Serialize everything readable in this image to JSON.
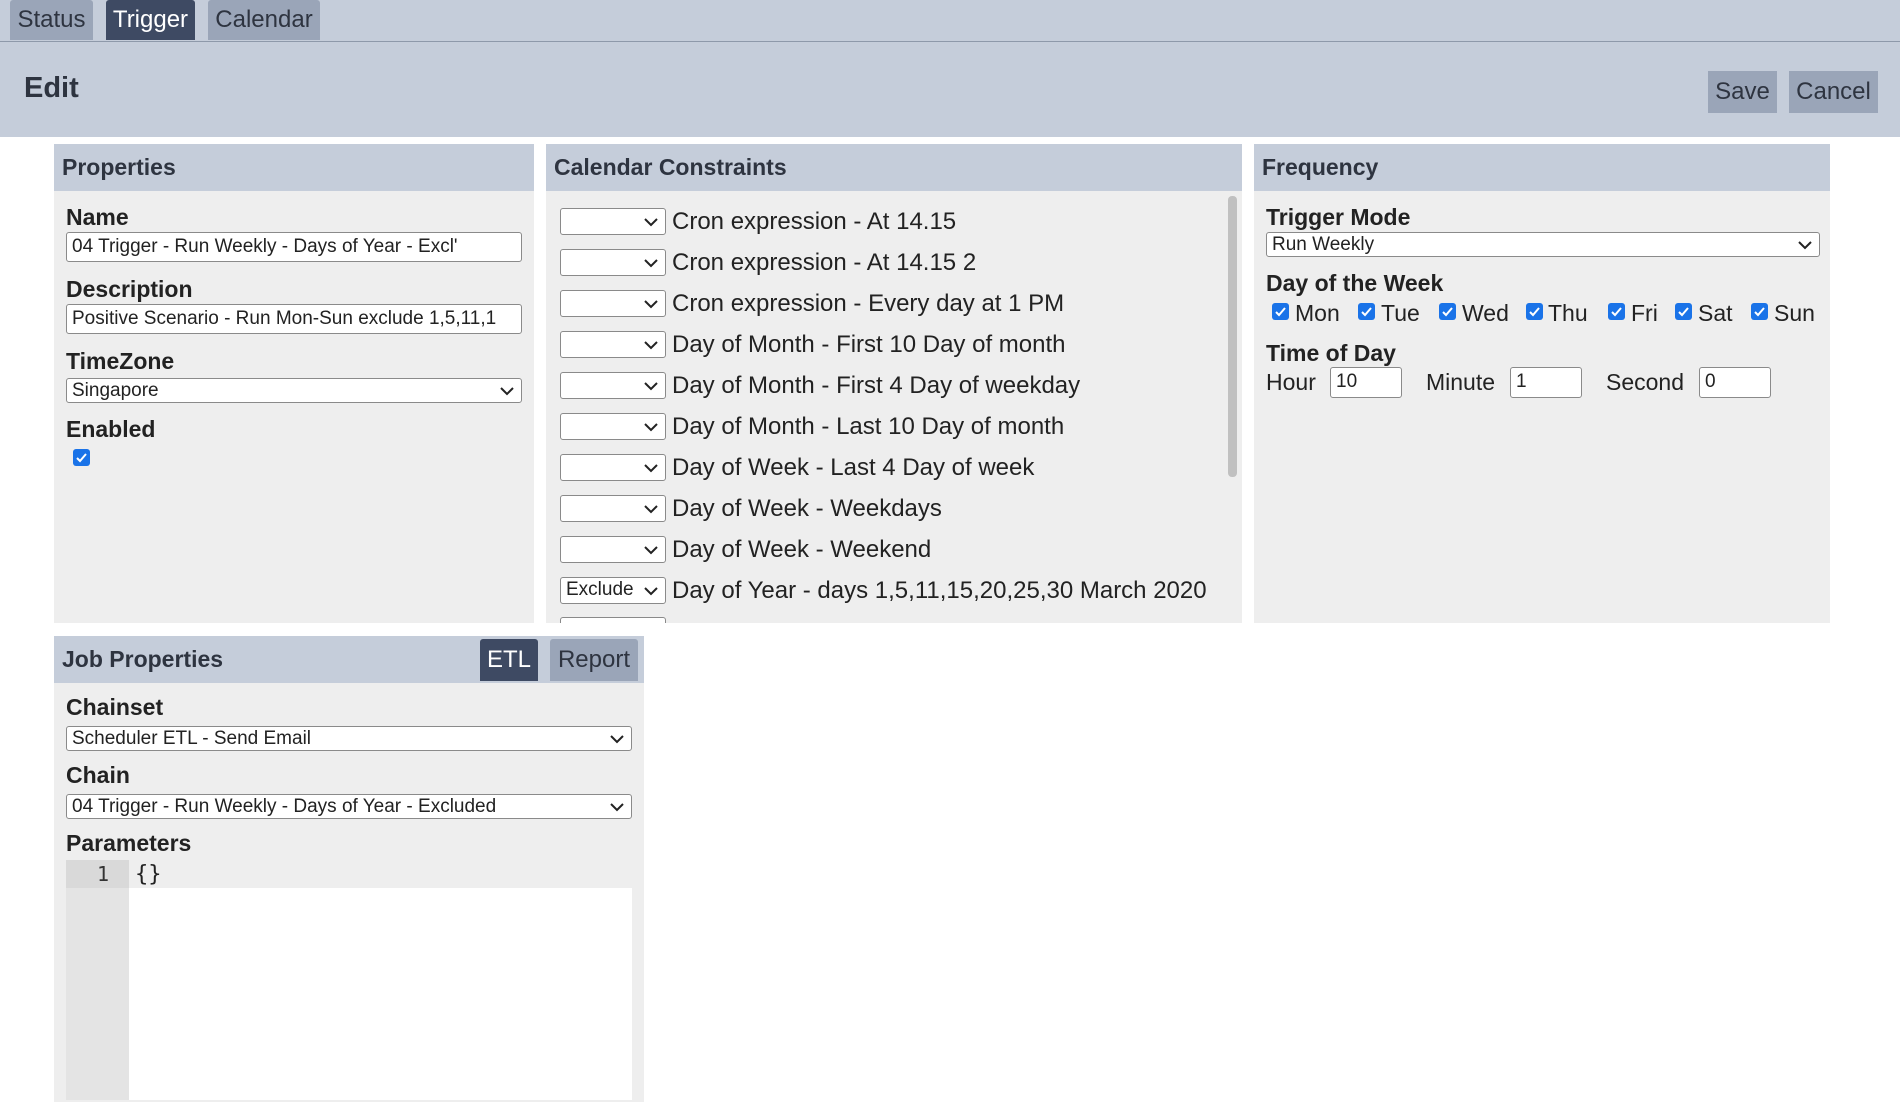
{
  "tabs": [
    {
      "label": "Status",
      "active": false
    },
    {
      "label": "Trigger",
      "active": true
    },
    {
      "label": "Calendar",
      "active": false
    }
  ],
  "header": {
    "title": "Edit",
    "save_label": "Save",
    "cancel_label": "Cancel"
  },
  "properties": {
    "title": "Properties",
    "name_label": "Name",
    "name_value": "04 Trigger - Run Weekly - Days of Year - Excl'",
    "description_label": "Description",
    "description_value": "Positive Scenario - Run Mon-Sun exclude  1,5,11,1",
    "timezone_label": "TimeZone",
    "timezone_value": "Singapore",
    "enabled_label": "Enabled",
    "enabled": true
  },
  "calendar": {
    "title": "Calendar Constraints",
    "rows": [
      {
        "select": "",
        "label": "Cron expression - At 14.15"
      },
      {
        "select": "",
        "label": "Cron expression - At 14.15 2"
      },
      {
        "select": "",
        "label": "Cron expression - Every day at 1 PM"
      },
      {
        "select": "",
        "label": "Day of Month - First 10 Day of month"
      },
      {
        "select": "",
        "label": "Day of Month - First 4 Day of weekday"
      },
      {
        "select": "",
        "label": "Day of Month - Last 10 Day of month"
      },
      {
        "select": "",
        "label": "Day of Week - Last 4 Day of week"
      },
      {
        "select": "",
        "label": "Day of Week - Weekdays"
      },
      {
        "select": "",
        "label": "Day of Week - Weekend"
      },
      {
        "select": "Exclude",
        "label": "Day of Year - days 1,5,11,15,20,25,30 March 2020"
      }
    ]
  },
  "frequency": {
    "title": "Frequency",
    "trigger_mode_label": "Trigger Mode",
    "trigger_mode_value": "Run Weekly",
    "dow_label": "Day of the Week",
    "days": [
      {
        "label": "Mon",
        "checked": true
      },
      {
        "label": "Tue",
        "checked": true
      },
      {
        "label": "Wed",
        "checked": true
      },
      {
        "label": "Thu",
        "checked": true
      },
      {
        "label": "Fri",
        "checked": true
      },
      {
        "label": "Sat",
        "checked": true
      },
      {
        "label": "Sun",
        "checked": true
      }
    ],
    "tod_label": "Time of Day",
    "hour_label": "Hour",
    "hour_value": "10",
    "minute_label": "Minute",
    "minute_value": "1",
    "second_label": "Second",
    "second_value": "0"
  },
  "job": {
    "title": "Job Properties",
    "tab_etl": "ETL",
    "tab_report": "Report",
    "chainset_label": "Chainset",
    "chainset_value": "Scheduler ETL - Send Email",
    "chain_label": "Chain",
    "chain_value": "04 Trigger - Run Weekly - Days of Year - Excluded",
    "parameters_label": "Parameters",
    "editor_line_number": "1",
    "editor_content": "{}"
  },
  "icons": {
    "dropdown": "chevron-down-icon",
    "checkbox": "checkmark-icon"
  },
  "colors": {
    "header_bg": "#c5cdda",
    "tab_active": "#3e4a63",
    "tab_inactive": "#9aa5b8",
    "panel_bg": "#eeeeee",
    "checkbox": "#1a73e8"
  }
}
